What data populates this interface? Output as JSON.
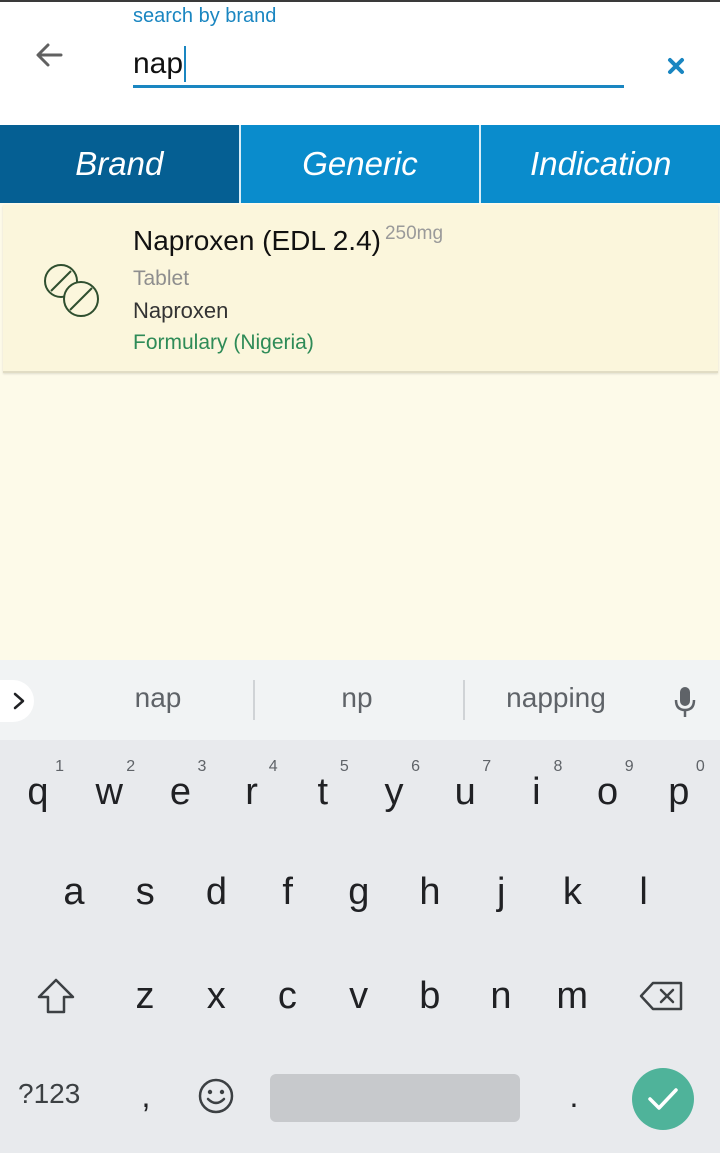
{
  "search": {
    "label": "search by brand",
    "value": "nap"
  },
  "tabs": [
    {
      "label": "Brand",
      "active": true
    },
    {
      "label": "Generic",
      "active": false
    },
    {
      "label": "Indication",
      "active": false
    }
  ],
  "result": {
    "name": "Naproxen (EDL 2.4)",
    "dose": "250mg",
    "form": "Tablet",
    "generic": "Naproxen",
    "formulary": "Formulary (Nigeria)"
  },
  "keyboard": {
    "suggestions": [
      "nap",
      "np",
      "napping"
    ],
    "row1": [
      {
        "key": "q",
        "hint": "1"
      },
      {
        "key": "w",
        "hint": "2"
      },
      {
        "key": "e",
        "hint": "3"
      },
      {
        "key": "r",
        "hint": "4"
      },
      {
        "key": "t",
        "hint": "5"
      },
      {
        "key": "y",
        "hint": "6"
      },
      {
        "key": "u",
        "hint": "7"
      },
      {
        "key": "i",
        "hint": "8"
      },
      {
        "key": "o",
        "hint": "9"
      },
      {
        "key": "p",
        "hint": "0"
      }
    ],
    "row2": [
      "a",
      "s",
      "d",
      "f",
      "g",
      "h",
      "j",
      "k",
      "l"
    ],
    "row3": [
      "z",
      "x",
      "c",
      "v",
      "b",
      "n",
      "m"
    ],
    "symbols_label": "?123",
    "comma": ",",
    "period": "."
  },
  "colors": {
    "accent": "#1a86c1",
    "tab_bg": "#0a8ccc",
    "tab_active": "#055f93",
    "list_bg": "#fdfae9",
    "formulary_text": "#2e8b57",
    "enter_key": "#4fb39a"
  }
}
